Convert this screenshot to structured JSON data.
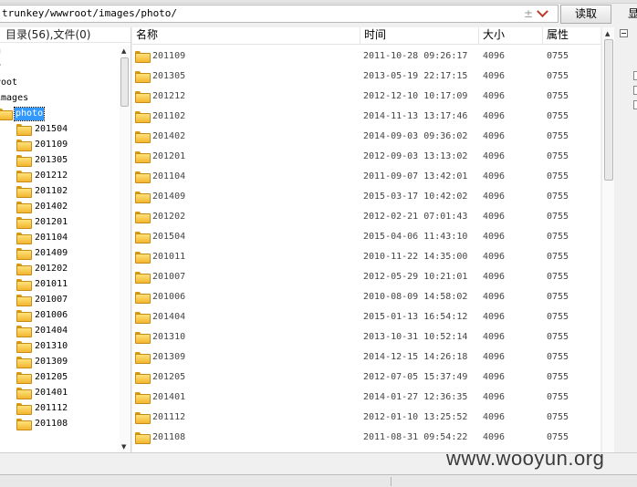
{
  "path_bar": {
    "path": "trunkey/wwwroot/images/photo/",
    "read_button": "读取",
    "right_edge": "显"
  },
  "tree": {
    "header": "目录(56),文件(0)",
    "ancestors": [
      "g",
      "y",
      "root",
      "images"
    ],
    "selected": "photo",
    "children": [
      "201504",
      "201109",
      "201305",
      "201212",
      "201102",
      "201402",
      "201201",
      "201104",
      "201409",
      "201202",
      "201011",
      "201007",
      "201006",
      "201404",
      "201310",
      "201309",
      "201205",
      "201401",
      "201112",
      "201108"
    ]
  },
  "list": {
    "columns": {
      "name": "名称",
      "time": "时间",
      "size": "大小",
      "attr": "属性"
    },
    "rows": [
      {
        "name": "201109",
        "time": "2011-10-28 09:26:17",
        "size": "4096",
        "attr": "0755"
      },
      {
        "name": "201305",
        "time": "2013-05-19 22:17:15",
        "size": "4096",
        "attr": "0755"
      },
      {
        "name": "201212",
        "time": "2012-12-10 10:17:09",
        "size": "4096",
        "attr": "0755"
      },
      {
        "name": "201102",
        "time": "2014-11-13 13:17:46",
        "size": "4096",
        "attr": "0755"
      },
      {
        "name": "201402",
        "time": "2014-09-03 09:36:02",
        "size": "4096",
        "attr": "0755"
      },
      {
        "name": "201201",
        "time": "2012-09-03 13:13:02",
        "size": "4096",
        "attr": "0755"
      },
      {
        "name": "201104",
        "time": "2011-09-07 13:42:01",
        "size": "4096",
        "attr": "0755"
      },
      {
        "name": "201409",
        "time": "2015-03-17 10:42:02",
        "size": "4096",
        "attr": "0755"
      },
      {
        "name": "201202",
        "time": "2012-02-21 07:01:43",
        "size": "4096",
        "attr": "0755"
      },
      {
        "name": "201504",
        "time": "2015-04-06 11:43:10",
        "size": "4096",
        "attr": "0755"
      },
      {
        "name": "201011",
        "time": "2010-11-22 14:35:00",
        "size": "4096",
        "attr": "0755"
      },
      {
        "name": "201007",
        "time": "2012-05-29 10:21:01",
        "size": "4096",
        "attr": "0755"
      },
      {
        "name": "201006",
        "time": "2010-08-09 14:58:02",
        "size": "4096",
        "attr": "0755"
      },
      {
        "name": "201404",
        "time": "2015-01-13 16:54:12",
        "size": "4096",
        "attr": "0755"
      },
      {
        "name": "201310",
        "time": "2013-10-31 10:52:14",
        "size": "4096",
        "attr": "0755"
      },
      {
        "name": "201309",
        "time": "2014-12-15 14:26:18",
        "size": "4096",
        "attr": "0755"
      },
      {
        "name": "201205",
        "time": "2012-07-05 15:37:49",
        "size": "4096",
        "attr": "0755"
      },
      {
        "name": "201401",
        "time": "2014-01-27 12:36:35",
        "size": "4096",
        "attr": "0755"
      },
      {
        "name": "201112",
        "time": "2012-01-10 13:25:52",
        "size": "4096",
        "attr": "0755"
      },
      {
        "name": "201108",
        "time": "2011-08-31 09:54:22",
        "size": "4096",
        "attr": "0755"
      }
    ]
  },
  "watermark": "www.wooyun.org",
  "icons": {
    "folder": "folder-icon",
    "path_pin": "pin-icon",
    "path_dropdown": "chevron-down-icon",
    "collapse": "minus-icon"
  },
  "colors": {
    "selection": "#3399ff",
    "folder_fill": "#f3b630",
    "dropdown_chevron": "#c0392b"
  }
}
